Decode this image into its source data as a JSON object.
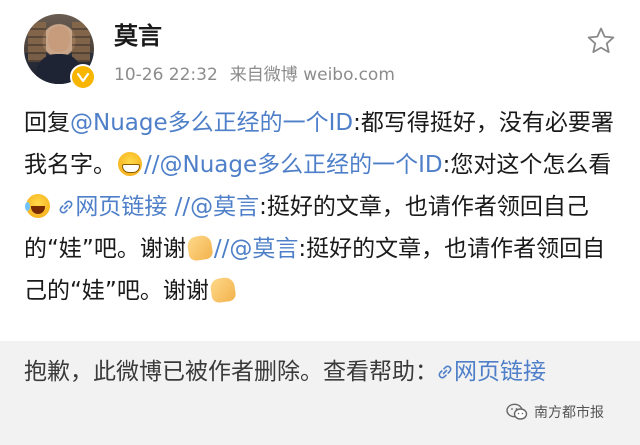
{
  "post": {
    "username": "莫言",
    "timestamp": "10-26 22:32",
    "source": "来自微博 weibo.com",
    "verified_icon": "verified-badge-icon",
    "star_icon": "star-icon",
    "content": {
      "seg1": "回复",
      "mention1": "@Nuage多么正经的一个ID",
      "seg2": ":都写得挺好，没有必要署我名字。",
      "emoji1": "grin-emoji",
      "seg3": "//",
      "mention2": "@Nuage多么正经的一个ID",
      "seg4": ":您对这个怎么看",
      "emoji2": "laugh-cry-emoji",
      "weblink1": "网页链接",
      "seg5": " //",
      "mention3": "@莫言",
      "seg6": ":挺好的文章，也请作者领回自己的“娃”吧。谢谢",
      "emoji3": "pray-emoji",
      "seg7": "//",
      "mention4": "@莫言",
      "seg8": ":挺好的文章，也请作者领回自己的“娃”吧。谢谢",
      "emoji4": "pray-emoji"
    }
  },
  "footer": {
    "notice": "抱歉，此微博已被作者删除。查看帮助：",
    "weblink": "网页链接"
  },
  "watermark": {
    "text": "南方都市报",
    "icon": "wechat-icon"
  },
  "colors": {
    "link": "#4e7fc8",
    "meta": "#8c8c8c",
    "footer_bg": "#f2f2f2",
    "verified": "#f7b500"
  }
}
